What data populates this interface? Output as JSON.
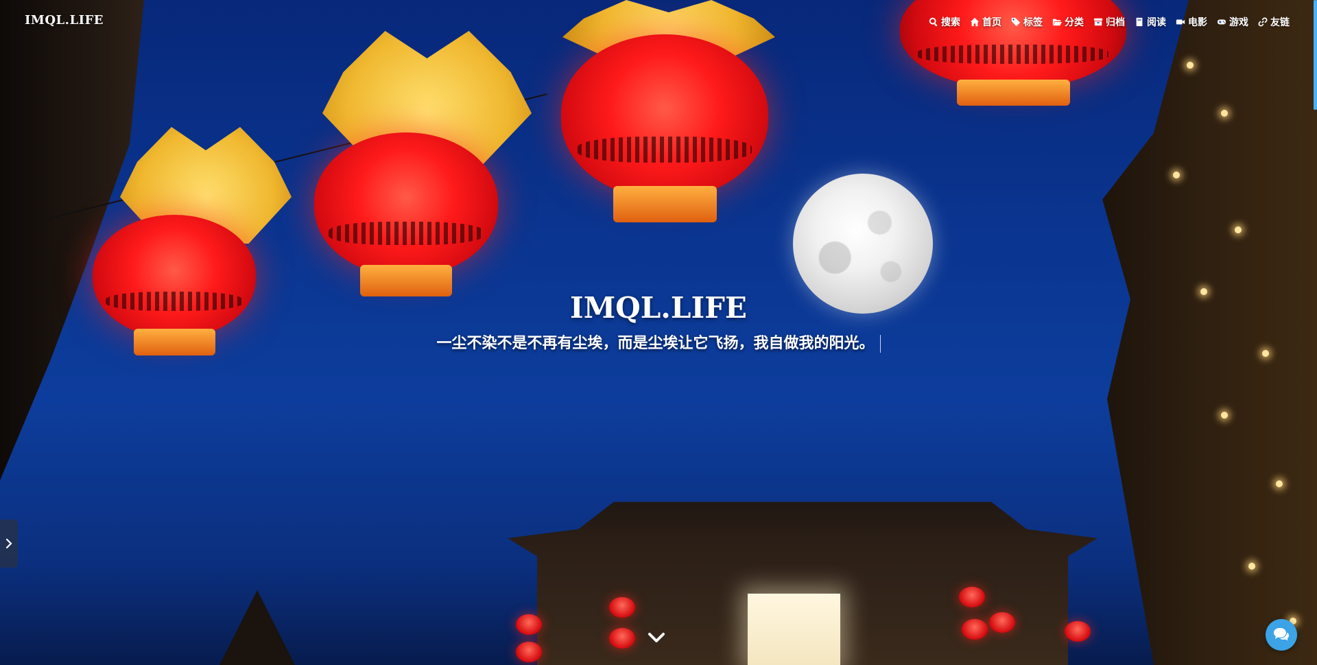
{
  "site": {
    "logo": "IMQL.LIFE"
  },
  "nav": {
    "items": [
      {
        "icon": "search-icon",
        "label": "搜索"
      },
      {
        "icon": "home-icon",
        "label": "首页"
      },
      {
        "icon": "tags-icon",
        "label": "标签"
      },
      {
        "icon": "folder-open-icon",
        "label": "分类"
      },
      {
        "icon": "archive-icon",
        "label": "归档"
      },
      {
        "icon": "book-icon",
        "label": "阅读"
      },
      {
        "icon": "video-icon",
        "label": "电影"
      },
      {
        "icon": "gamepad-icon",
        "label": "游戏"
      },
      {
        "icon": "link-icon",
        "label": "友链"
      }
    ]
  },
  "hero": {
    "title": "IMQL.LIFE",
    "subtitle": "一尘不染不是不再有尘埃，而是尘埃让它飞扬，我自做我的阳光。"
  },
  "icons": {
    "scroll_down": "chevron-down-icon",
    "sidebar_toggle": "chevron-right-icon",
    "chat": "chat-icon"
  },
  "colors": {
    "sky": "#0a3590",
    "accent": "#49b1f5",
    "chat": "#3ba3e6"
  }
}
